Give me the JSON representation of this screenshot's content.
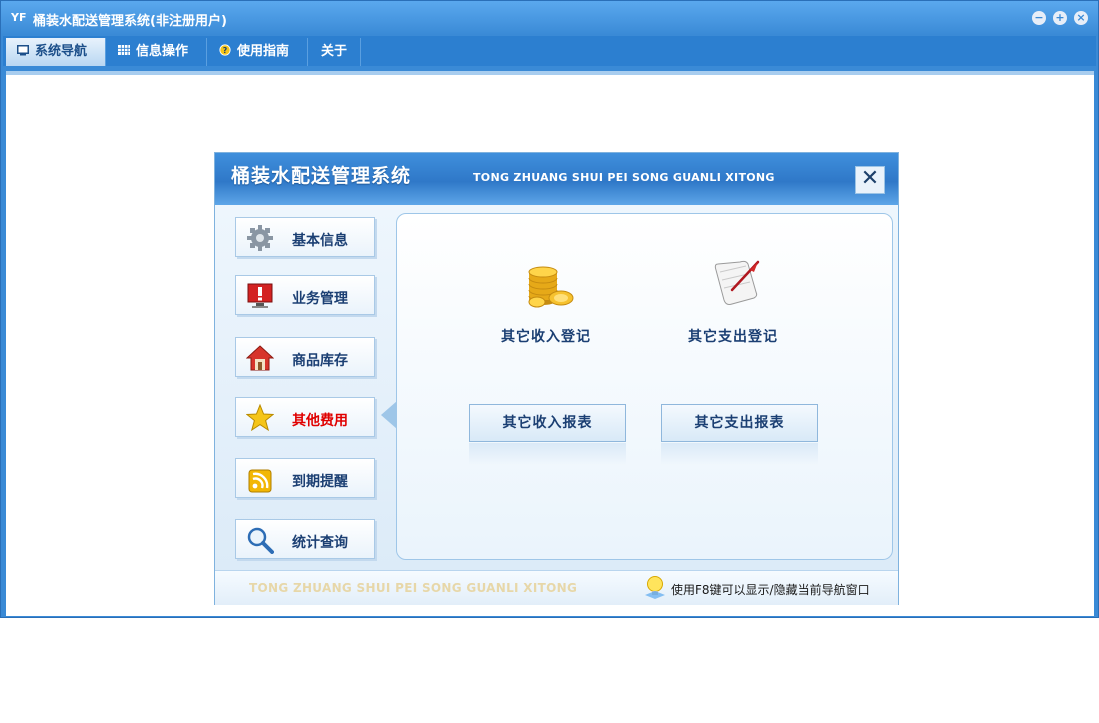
{
  "window": {
    "logo": "YF",
    "title": "桶装水配送管理系统(非注册用户)",
    "controls": [
      "minimize-icon",
      "maximize-icon",
      "close-icon"
    ]
  },
  "menu": [
    {
      "label": "系统导航",
      "icon": "monitor-icon",
      "active": true
    },
    {
      "label": "信息操作",
      "icon": "grid-icon",
      "active": false
    },
    {
      "label": "使用指南",
      "icon": "help-icon",
      "active": false
    },
    {
      "label": "关于",
      "icon": "",
      "active": false
    }
  ],
  "dialog": {
    "title": "桶装水配送管理系统",
    "subtitle": "TONG ZHUANG SHUI PEI SONG GUANLI XITONG",
    "close_glyph": "✕",
    "sidebar": [
      {
        "label": "基本信息",
        "icon": "gear-icon",
        "active": false
      },
      {
        "label": "业务管理",
        "icon": "alert-monitor-icon",
        "active": false
      },
      {
        "label": "商品库存",
        "icon": "house-icon",
        "active": false
      },
      {
        "label": "其他费用",
        "icon": "star-icon",
        "active": true
      },
      {
        "label": "到期提醒",
        "icon": "rss-icon",
        "active": false
      },
      {
        "label": "统计查询",
        "icon": "magnifier-icon",
        "active": false
      }
    ],
    "functions": [
      {
        "label": "其它收入登记",
        "icon": "coins-icon"
      },
      {
        "label": "其它支出登记",
        "icon": "scroll-quill-icon"
      }
    ],
    "reports": [
      {
        "label": "其它收入报表"
      },
      {
        "label": "其它支出报表"
      }
    ],
    "footer": {
      "watermark": "TONG ZHUANG SHUI PEI SONG GUANLI XITONG",
      "tip": "使用F8键可以显示/隐藏当前导航窗口"
    }
  },
  "colors": {
    "title_bar": "#3a8ad6",
    "menu_bar": "#2c7fd0",
    "active_item_text": "#e00000",
    "label_text": "#1b3f73"
  }
}
